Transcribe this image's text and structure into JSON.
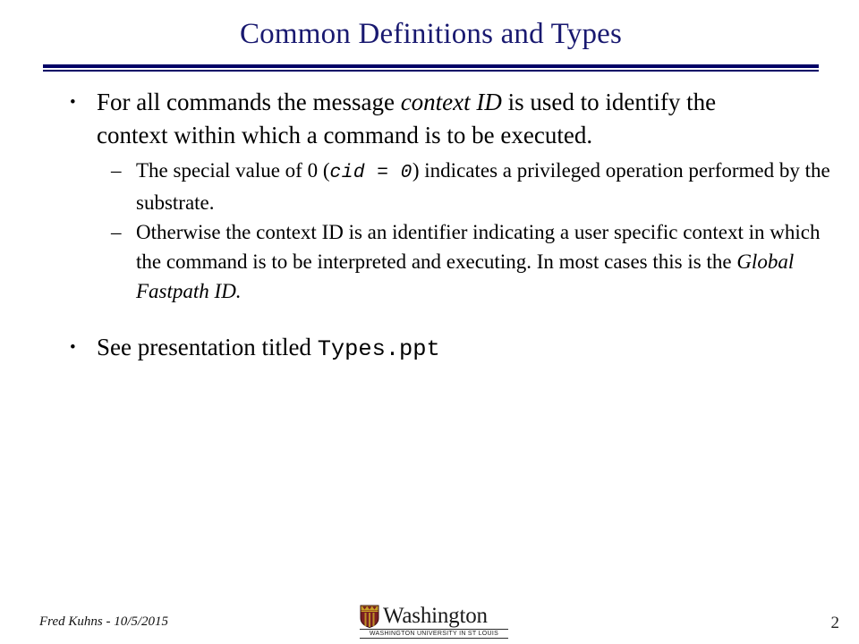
{
  "slide": {
    "title": "Common Definitions and Types",
    "title_color": "#191970",
    "rule_color": "#000066",
    "page_number": "2"
  },
  "body": {
    "bullet1": {
      "marker": "•",
      "text_part1": "For all commands the message ",
      "italic1": "context ID",
      "text_part2": " is used to identify the context within which a command is to be executed."
    },
    "sub1": {
      "marker": "–",
      "text_part1": "The special value of 0 (",
      "code1": "cid = 0",
      "text_part2": ") indicates a privileged operation performed by the substrate."
    },
    "sub2": {
      "marker": "–",
      "text_part1": "Otherwise the context ID is an identifier indicating a user specific context in which the command is to be interpreted and executing.  In most cases this is the ",
      "italic1": "Global Fastpath ID."
    },
    "bullet2": {
      "marker": "•",
      "text_part1": "See presentation titled ",
      "code1": "Types.ppt"
    }
  },
  "footer": {
    "author": "Fred Kuhns - 10/5/2015",
    "logo_word": "Washington",
    "logo_subtitle": "WASHINGTON UNIVERSITY IN ST LOUIS",
    "page_number": "2"
  }
}
